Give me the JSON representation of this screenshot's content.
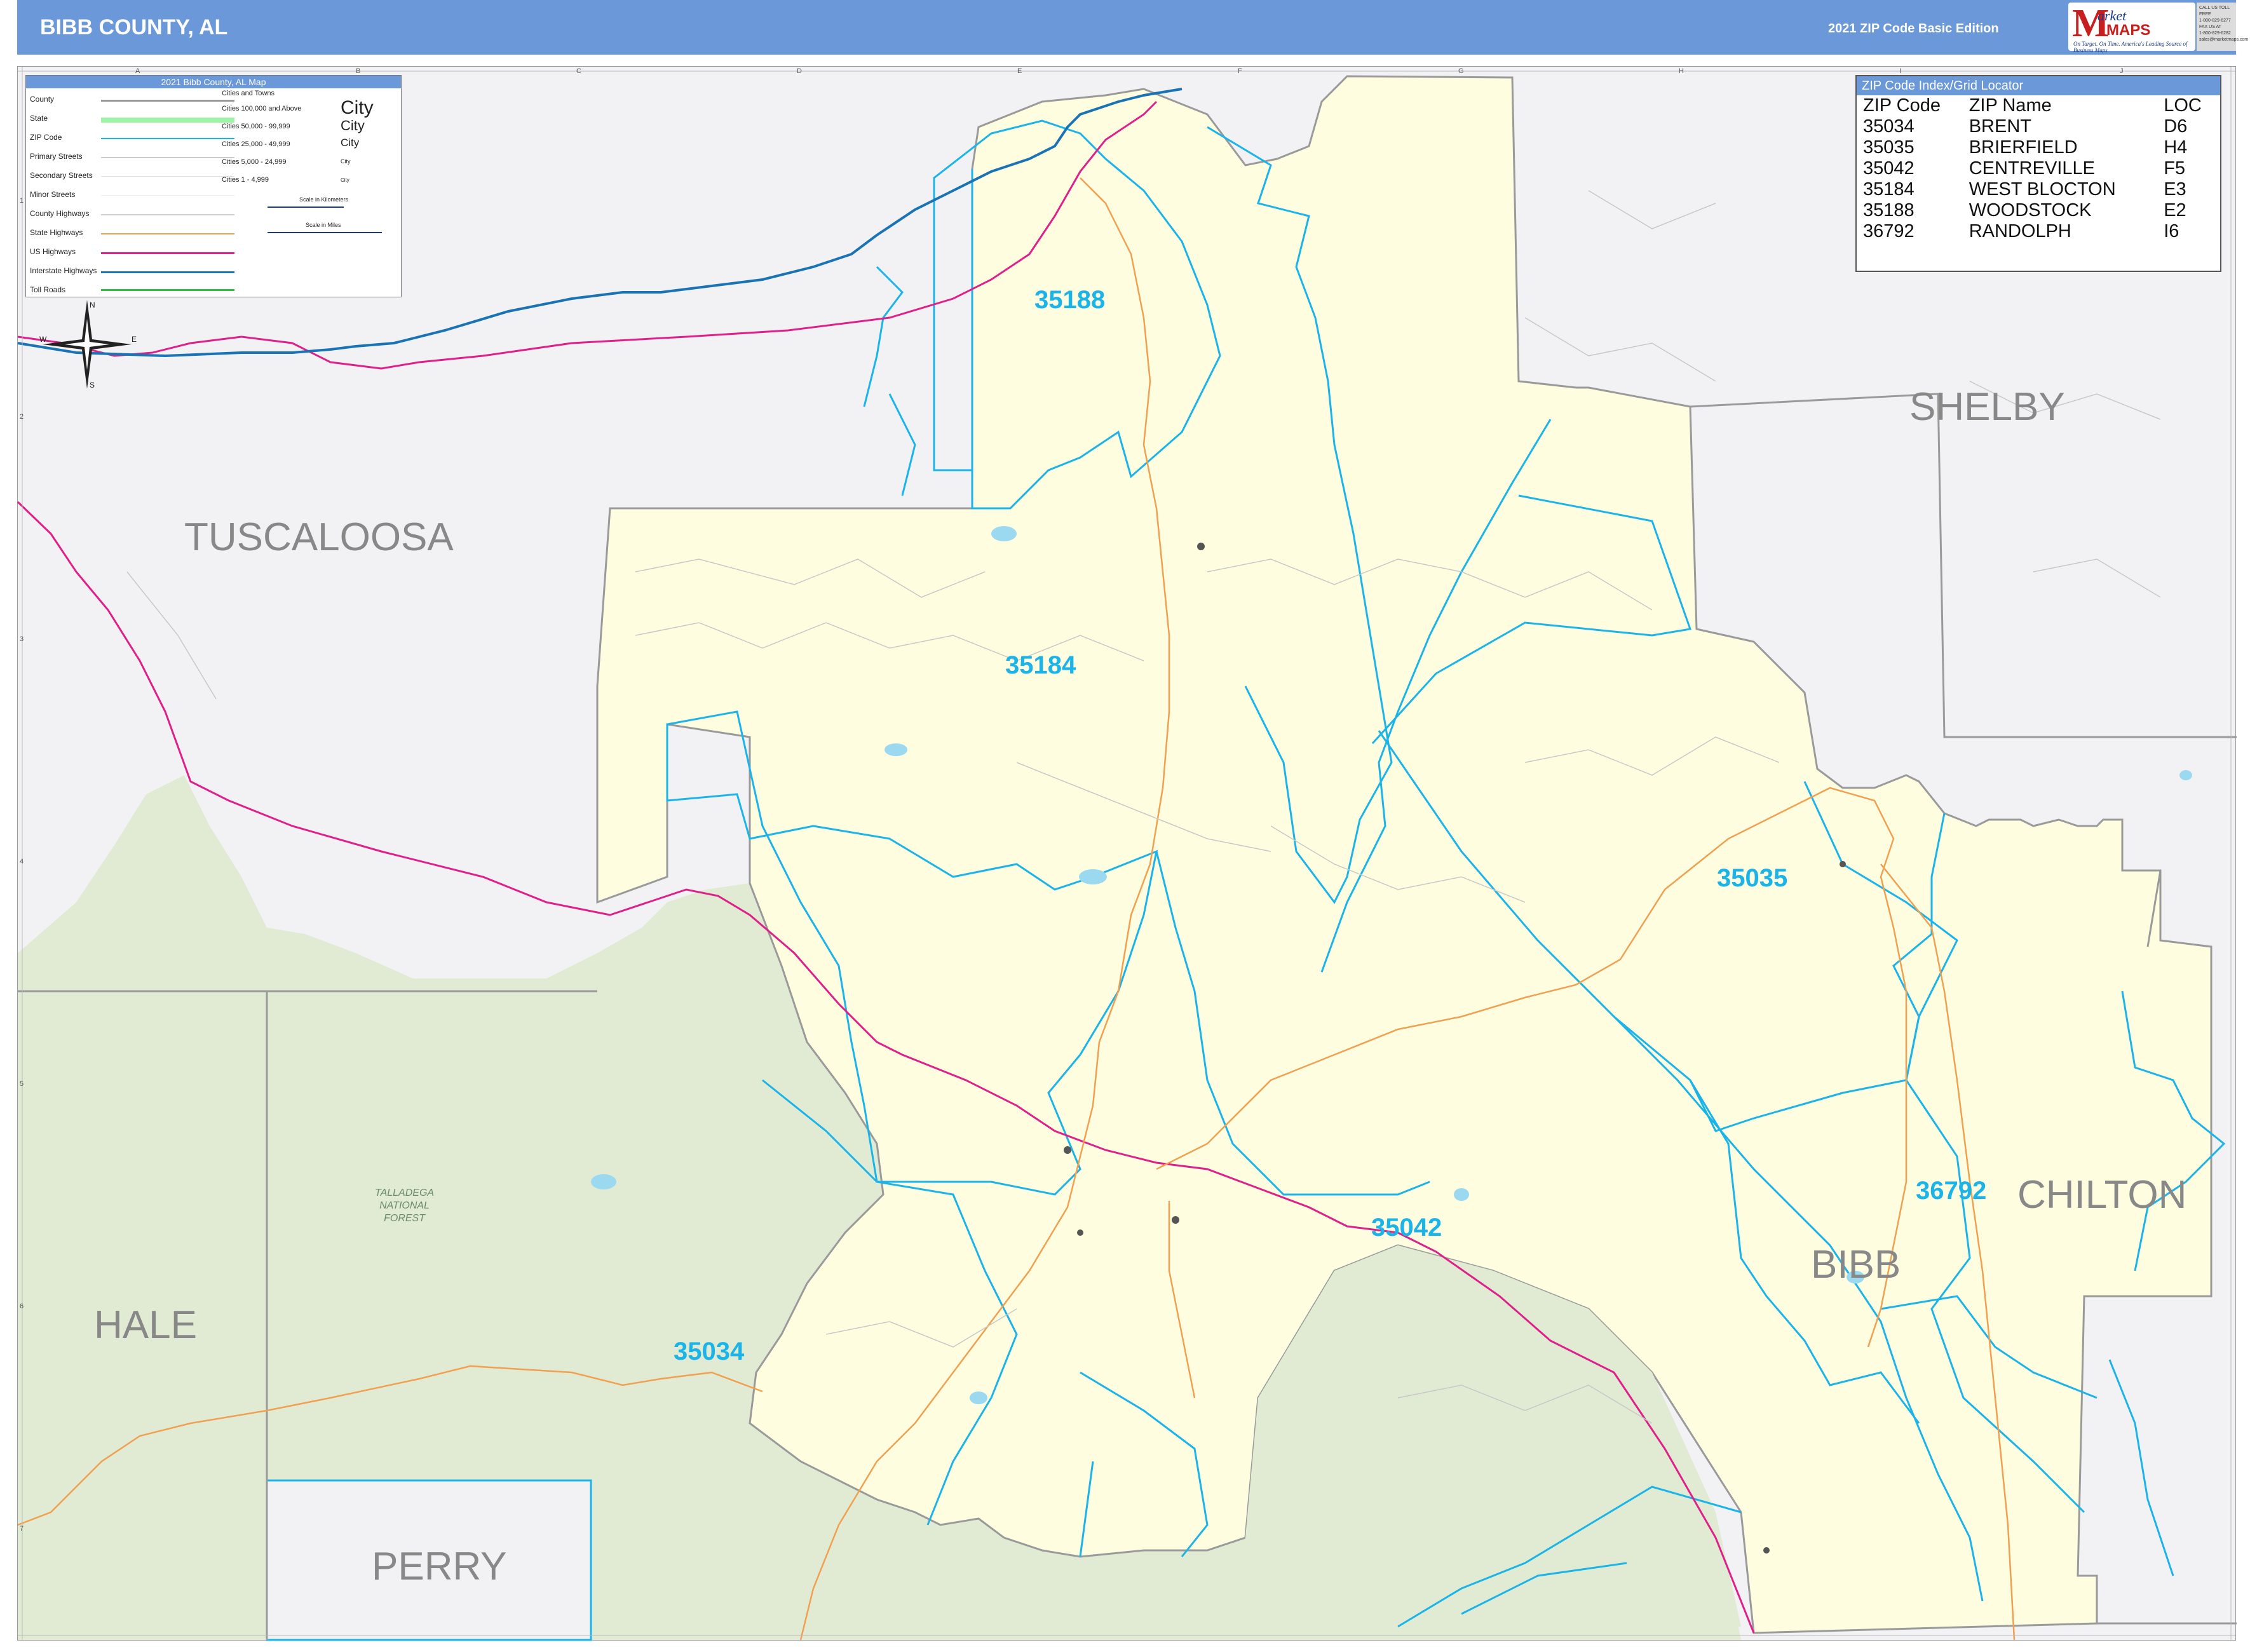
{
  "header": {
    "title": "BIBB COUNTY, AL",
    "edition": "2021 ZIP Code Basic Edition",
    "logo_text_market": "arket",
    "logo_text_maps": "MAPS",
    "logo_letter": "M",
    "logo_tagline": "On Target. On Time. America's Leading Source of Business Maps",
    "contact_lines": [
      "CALL US TOLL FREE",
      "1-800-829-6277",
      "FAX US AT",
      "1-800-829-6282",
      "sales@marketmaps.com"
    ]
  },
  "legend": {
    "title": "2021 Bibb County, AL Map",
    "items": [
      {
        "label": "County",
        "color": "#9a9a9a"
      },
      {
        "label": "State",
        "color": "#9df3a6"
      },
      {
        "label": "ZIP Code",
        "color": "#1ab4e8"
      },
      {
        "label": "Primary Streets",
        "color": "#cccccc"
      },
      {
        "label": "Secondary Streets",
        "color": "#dddddd"
      },
      {
        "label": "Minor Streets",
        "color": "#eeeeee"
      },
      {
        "label": "County Highways",
        "color": "#d0d0d0"
      },
      {
        "label": "State Highways",
        "color": "#f0a050"
      },
      {
        "label": "US Highways",
        "color": "#e0208a"
      },
      {
        "label": "Interstate Highways",
        "color": "#1a73b5"
      },
      {
        "label": "Toll Roads",
        "color": "#2fbf3f"
      }
    ],
    "cities": [
      {
        "label": "Cities and Towns",
        "sample": ""
      },
      {
        "label": "Cities 100,000 and Above",
        "sample": "City"
      },
      {
        "label": "Cities 50,000 - 99,999",
        "sample": "City"
      },
      {
        "label": "Cities 25,000 - 49,999",
        "sample": "City"
      },
      {
        "label": "Cities 5,000 - 24,999",
        "sample": "City"
      },
      {
        "label": "Cities 1 - 4,999",
        "sample": "City"
      }
    ],
    "scale_km": "Scale in Kilometers",
    "scale_mi": "Scale in Miles"
  },
  "zip_index": {
    "title": "ZIP Code Index/Grid Locator",
    "columns": [
      "ZIP Code",
      "ZIP Name",
      "LOC"
    ],
    "rows": [
      [
        "35034",
        "BRENT",
        "D6"
      ],
      [
        "35035",
        "BRIERFIELD",
        "H4"
      ],
      [
        "35042",
        "CENTREVILLE",
        "F5"
      ],
      [
        "35184",
        "WEST BLOCTON",
        "E3"
      ],
      [
        "35188",
        "WOODSTOCK",
        "E2"
      ],
      [
        "36792",
        "RANDOLPH",
        "I6"
      ]
    ]
  },
  "map": {
    "counties": [
      "SHELBY",
      "TUSCALOOSA",
      "CHILTON",
      "BIBB",
      "HALE",
      "PERRY"
    ],
    "zip_labels": [
      "35188",
      "35184",
      "35035",
      "36792",
      "35042",
      "35034"
    ],
    "forest_label": "TALLADEGA\nNATIONAL\nFOREST",
    "grid_cols": [
      "A",
      "B",
      "C",
      "D",
      "E",
      "F",
      "G",
      "H",
      "I",
      "J"
    ],
    "grid_rows": [
      "1",
      "2",
      "3",
      "4",
      "5",
      "6",
      "7"
    ],
    "compass": [
      "N",
      "S",
      "E",
      "W"
    ],
    "colors": {
      "bibb_fill": "#fefde0",
      "forest_fill": "#e1ebd3",
      "outside_fill": "#f2f2f4",
      "zip_line": "#1ab4e8",
      "county_line": "#9a9a9a",
      "us_highway": "#e0208a",
      "interstate": "#1a73b5",
      "state_highway": "#f0a050"
    }
  }
}
